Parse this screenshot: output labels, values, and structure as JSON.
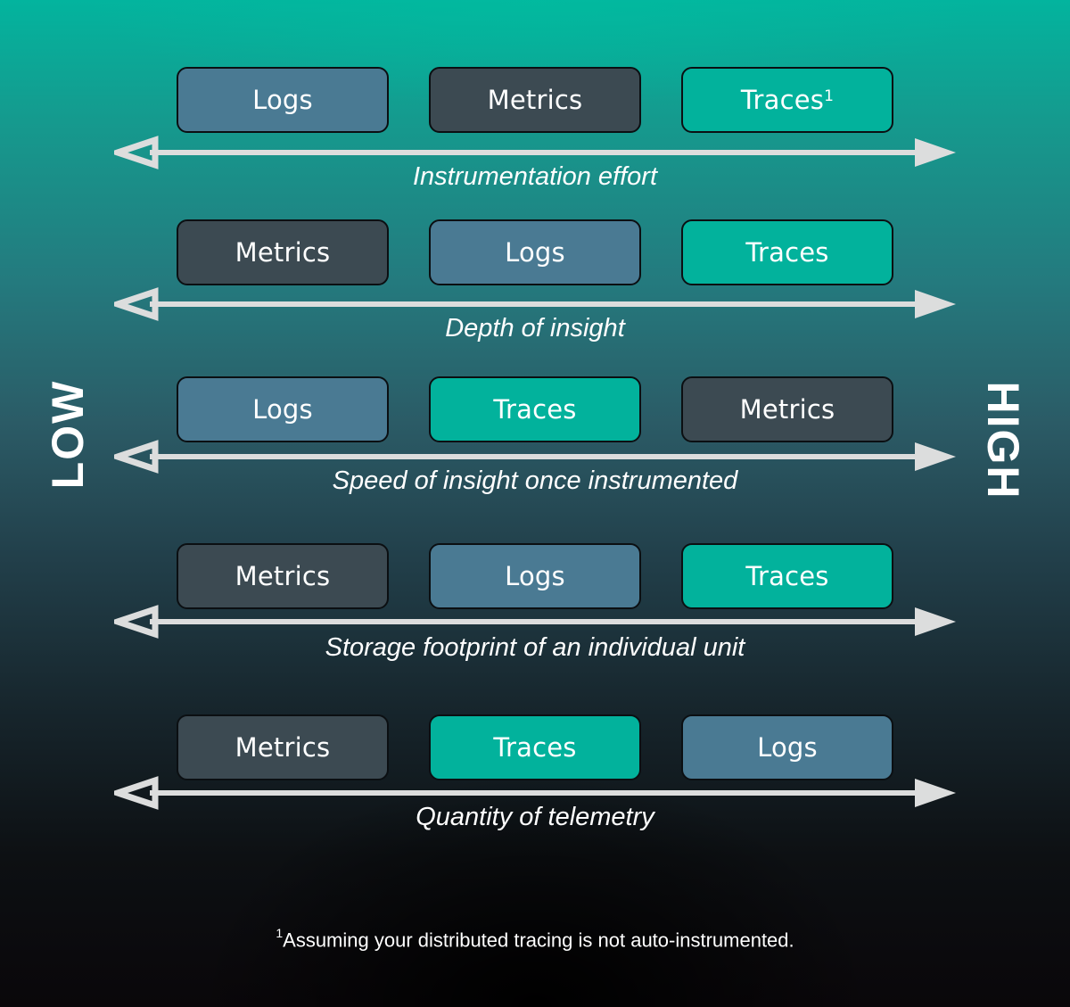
{
  "side_labels": {
    "low": "LOW",
    "high": "HIGH"
  },
  "colors": {
    "logs": "#4a7a93",
    "metrics": "#3c4a52",
    "traces": "#02b29c",
    "arrow": "#dcdddd"
  },
  "scales": [
    {
      "label": "Instrumentation effort",
      "items": [
        {
          "name": "Logs",
          "type": "logs",
          "sup": ""
        },
        {
          "name": "Metrics",
          "type": "metrics",
          "sup": ""
        },
        {
          "name": "Traces",
          "type": "traces",
          "sup": "1"
        }
      ]
    },
    {
      "label": "Depth of insight",
      "items": [
        {
          "name": "Metrics",
          "type": "metrics",
          "sup": ""
        },
        {
          "name": "Logs",
          "type": "logs",
          "sup": ""
        },
        {
          "name": "Traces",
          "type": "traces",
          "sup": ""
        }
      ]
    },
    {
      "label": "Speed of insight once instrumented",
      "items": [
        {
          "name": "Logs",
          "type": "logs",
          "sup": ""
        },
        {
          "name": "Traces",
          "type": "traces",
          "sup": ""
        },
        {
          "name": "Metrics",
          "type": "metrics",
          "sup": ""
        }
      ]
    },
    {
      "label": "Storage footprint of an individual unit",
      "items": [
        {
          "name": "Metrics",
          "type": "metrics",
          "sup": ""
        },
        {
          "name": "Logs",
          "type": "logs",
          "sup": ""
        },
        {
          "name": "Traces",
          "type": "traces",
          "sup": ""
        }
      ]
    },
    {
      "label": "Quantity of telemetry",
      "items": [
        {
          "name": "Metrics",
          "type": "metrics",
          "sup": ""
        },
        {
          "name": "Traces",
          "type": "traces",
          "sup": ""
        },
        {
          "name": "Logs",
          "type": "logs",
          "sup": ""
        }
      ]
    }
  ],
  "footnote": {
    "marker": "1",
    "text": "Assuming your distributed tracing is not auto-instrumented."
  }
}
